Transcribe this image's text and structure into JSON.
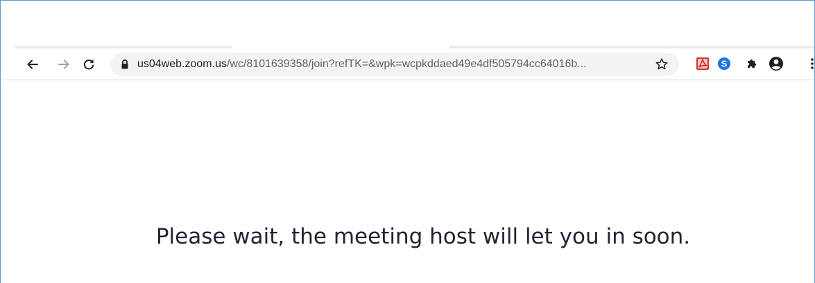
{
  "browser": {
    "url": {
      "host": "us04web.zoom.us",
      "path": "/wc/8101639358/join?refTK=&wpk=wcpkddaed49e4df505794cc64016b..."
    },
    "icons": {
      "back": "back-arrow-icon",
      "forward": "forward-arrow-icon",
      "reload": "reload-icon",
      "lock": "lock-icon",
      "bookmark": "star-icon",
      "pdf_extension": "adobe-pdf-icon",
      "skype_extension": "skype-icon",
      "extensions": "puzzle-icon",
      "profile": "profile-icon",
      "menu": "kebab-menu-icon"
    },
    "colors": {
      "frame_border": "#5b9bd5",
      "omnibox_bg": "#f1f3f4",
      "pdf_red": "#d93025",
      "skype_blue": "#1a73e8"
    }
  },
  "page": {
    "message": "Please wait, the meeting host will let you in soon."
  }
}
